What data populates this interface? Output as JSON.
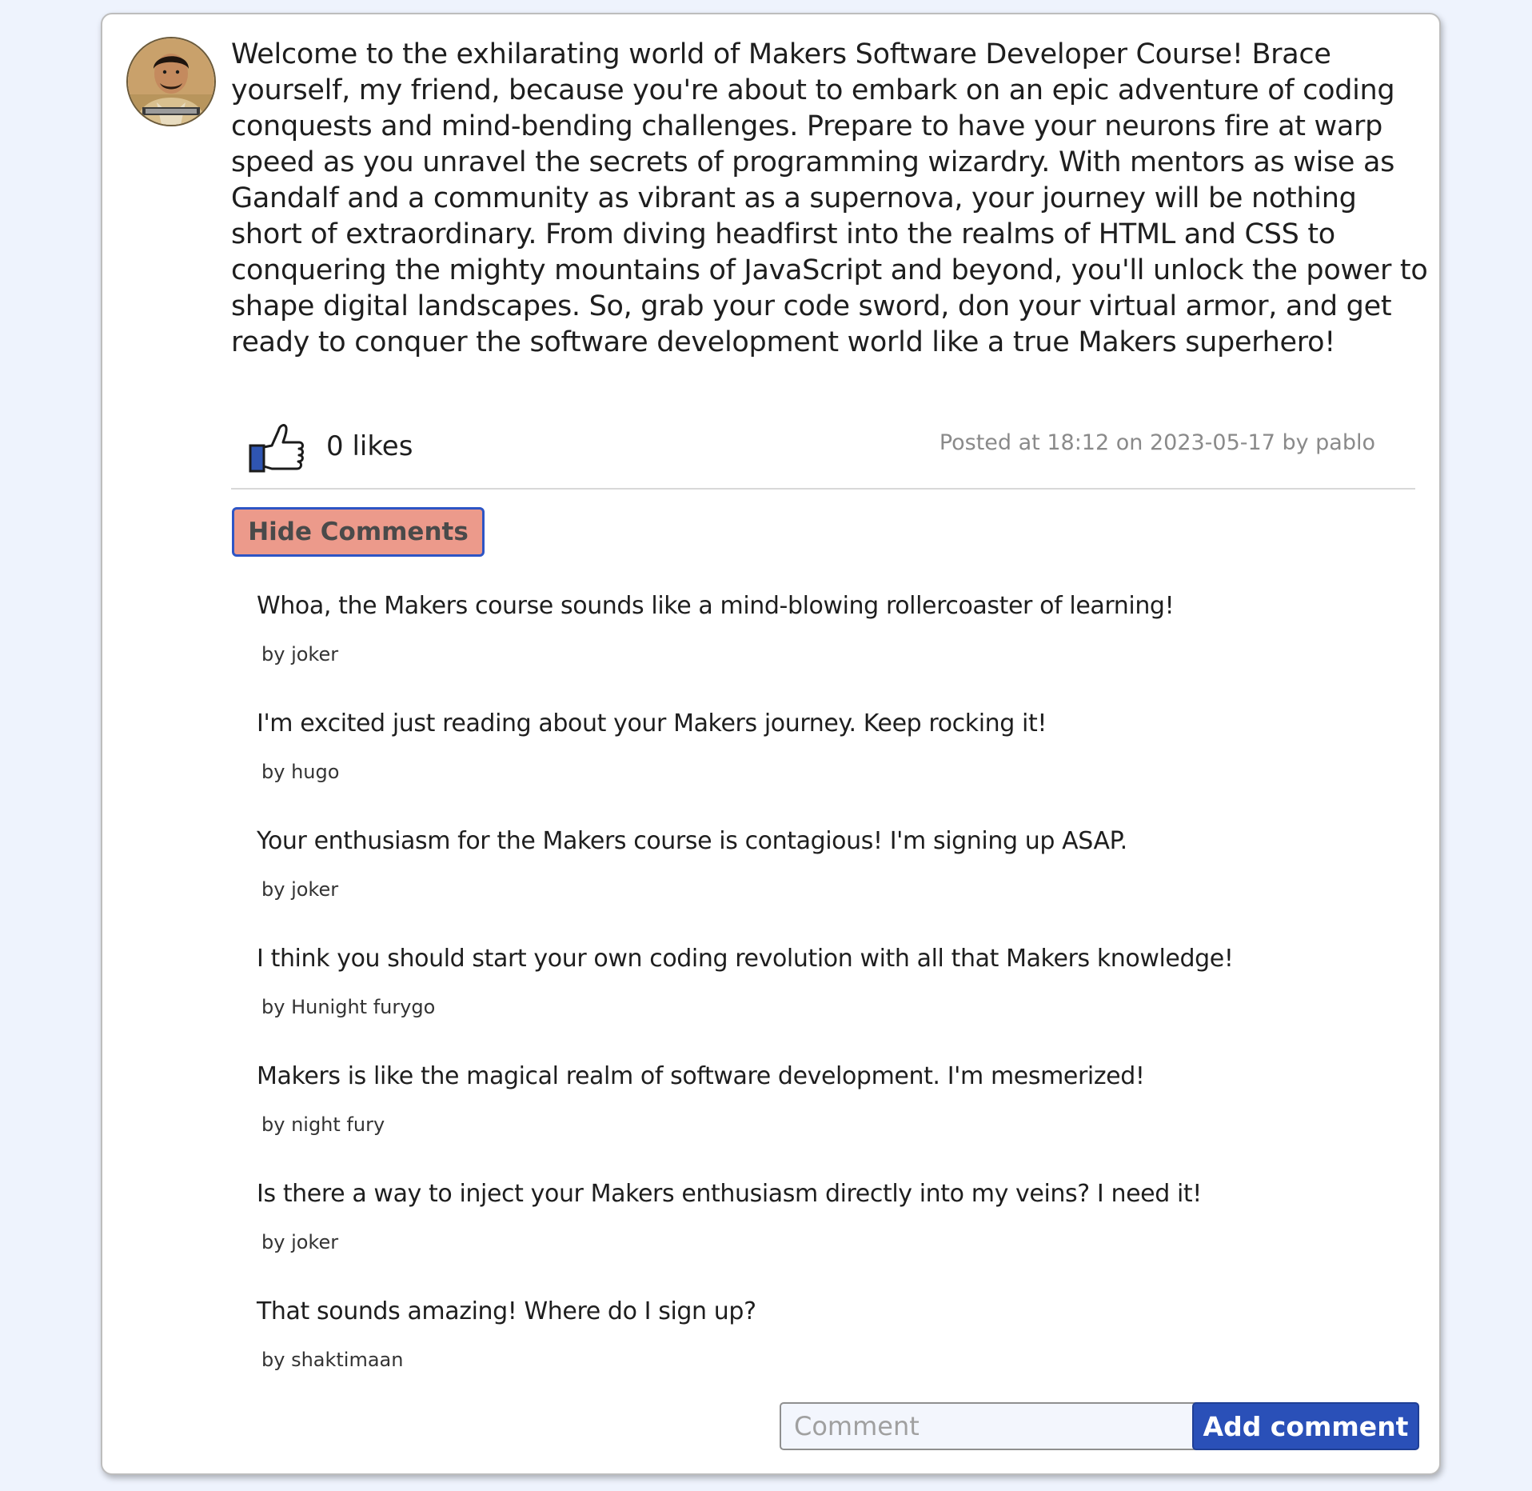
{
  "post": {
    "avatar_icon": "user-avatar-photo",
    "text": "Welcome to the exhilarating world of Makers Software Developer Course! Brace yourself, my friend, because you're about to embark on an epic adventure of coding conquests and mind-bending challenges. Prepare to have your neurons fire at warp speed as you unravel the secrets of programming wizardry. With mentors as wise as Gandalf and a community as vibrant as a supernova, your journey will be nothing short of extraordinary. From diving headfirst into the realms of HTML and CSS to conquering the mighty mountains of JavaScript and beyond, you'll unlock the power to shape digital landscapes. So, grab your code sword, don your virtual armor, and get ready to conquer the software development world like a true Makers superhero!",
    "likes_label": "0 likes",
    "like_icon": "thumbs-up-icon",
    "posted_at": "Posted at 18:12 on 2023-05-17 by pablo"
  },
  "comments_section": {
    "toggle_label": "Hide Comments",
    "comments": [
      {
        "text": "Whoa, the Makers course sounds like a mind-blowing rollercoaster of learning!",
        "author": "by joker"
      },
      {
        "text": "I'm excited just reading about your Makers journey. Keep rocking it!",
        "author": "by hugo"
      },
      {
        "text": "Your enthusiasm for the Makers course is contagious! I'm signing up ASAP.",
        "author": "by joker"
      },
      {
        "text": "I think you should start your own coding revolution with all that Makers knowledge!",
        "author": "by Hunight furygo"
      },
      {
        "text": "Makers is like the magical realm of software development. I'm mesmerized!",
        "author": "by night fury"
      },
      {
        "text": "Is there a way to inject your Makers enthusiasm directly into my veins? I need it!",
        "author": "by joker"
      },
      {
        "text": "That sounds amazing! Where do I sign up?",
        "author": "by shaktimaan"
      }
    ],
    "input_placeholder": "Comment",
    "add_label": "Add comment"
  },
  "colors": {
    "page_background": "#eef3fd",
    "toggle_button": "#ec9a8b",
    "accent_blue": "#2a50b8"
  }
}
